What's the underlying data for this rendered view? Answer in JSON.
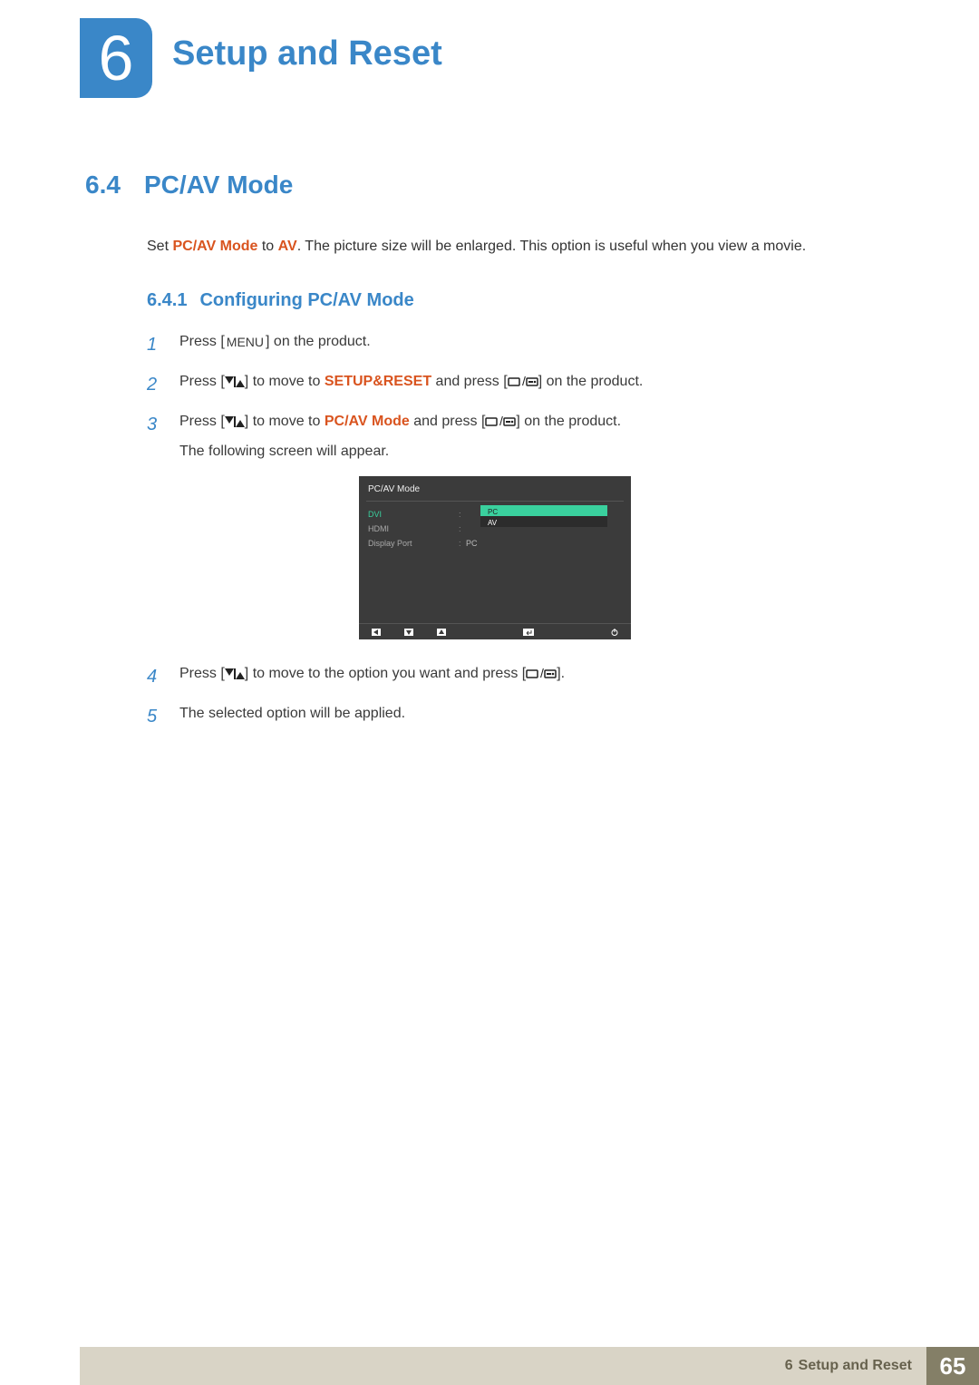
{
  "chapter": {
    "number": "6",
    "title": "Setup and Reset"
  },
  "section": {
    "number": "6.4",
    "title": "PC/AV Mode",
    "intro_pre": "Set ",
    "intro_hl1": "PC/AV Mode",
    "intro_mid": " to ",
    "intro_hl2": "AV",
    "intro_post": ". The picture size will be enlarged. This option is useful when you view a movie."
  },
  "subsection": {
    "number": "6.4.1",
    "title": "Configuring PC/AV Mode"
  },
  "labels": {
    "menu": "MENU"
  },
  "steps": {
    "s1": {
      "num": "1",
      "a": "Press [",
      "b": "] on the product."
    },
    "s2": {
      "num": "2",
      "a": "Press [",
      "b": "] to move to ",
      "hl": "SETUP&RESET",
      "c": " and press [",
      "d": "] on the product."
    },
    "s3": {
      "num": "3",
      "a": "Press [",
      "b": "] to move to ",
      "hl": "PC/AV Mode",
      "c": " and press [",
      "d": "] on the product.",
      "e": "The following screen will appear."
    },
    "s4": {
      "num": "4",
      "a": "Press [",
      "b": "] to move to the option you want and press [",
      "c": "]."
    },
    "s5": {
      "num": "5",
      "a": "The selected option will be applied."
    }
  },
  "osd": {
    "title": "PC/AV Mode",
    "rows": {
      "dvi": {
        "label": "DVI"
      },
      "hdmi": {
        "label": "HDMI"
      },
      "dp": {
        "label": "Display Port",
        "value": "PC"
      }
    },
    "options": {
      "pc": "PC",
      "av": "AV"
    }
  },
  "footer": {
    "chapter_num": "6",
    "chapter_title": "Setup and Reset",
    "page": "65"
  }
}
